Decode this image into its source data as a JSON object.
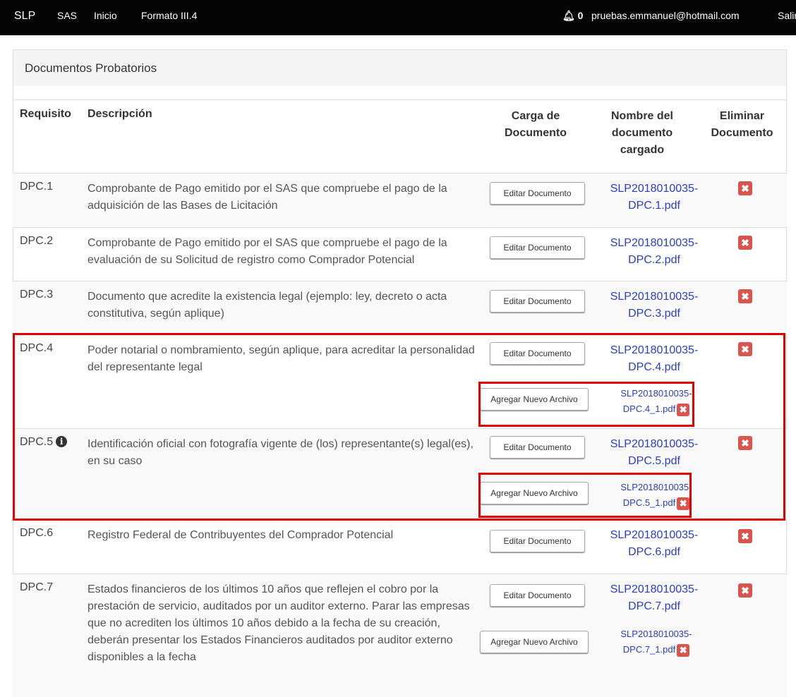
{
  "nav": {
    "brand": "SLP",
    "sas": "SAS",
    "inicio": "Inicio",
    "formato": "Formato III.4",
    "notifications": "0",
    "email": "pruebas.emmanuel@hotmail.com",
    "salir": "Salir"
  },
  "panel": {
    "title": "Documentos Probatorios"
  },
  "table": {
    "headers": {
      "requisito": "Requisito",
      "descripcion": "Descripción",
      "carga": "Carga de Documento",
      "nombre": "Nombre del documento cargado",
      "eliminar": "Eliminar Documento"
    },
    "rows": [
      {
        "req": "DPC.1",
        "desc": "Comprobante de Pago emitido por el SAS que compruebe el pago de la adquisición de las Bases de Licitación",
        "edit_label": "Editar Documento",
        "file": "SLP2018010035-DPC.1.pdf"
      },
      {
        "req": "DPC.2",
        "desc": "Comprobante de Pago emitido por el SAS que compruebe el pago de la evaluación de su Solicitud de registro como Comprador Potencial",
        "edit_label": "Editar Documento",
        "file": "SLP2018010035-DPC.2.pdf"
      },
      {
        "req": "DPC.3",
        "desc": "Documento que acredite la existencia legal (ejemplo: ley, decreto o acta constitutiva, según aplique)",
        "edit_label": "Editar Documento",
        "file": "SLP2018010035-DPC.3.pdf"
      },
      {
        "req": "DPC.4",
        "desc": "Poder notarial o nombramiento, según aplique, para acreditar la personalidad del representante legal",
        "edit_label": "Editar Documento",
        "file": "SLP2018010035-DPC.4.pdf",
        "add_label": "Agregar Nuevo Archivo",
        "extra_file": "SLP2018010035-DPC.4_1.pdf"
      },
      {
        "req": "DPC.5",
        "desc": "Identificación oficial con fotografía vigente de (los) representante(s) legal(es), en su caso",
        "edit_label": "Editar Documento",
        "file": "SLP2018010035-DPC.5.pdf",
        "add_label": "Agregar Nuevo Archivo",
        "extra_file": "SLP2018010035-DPC.5_1.pdf"
      },
      {
        "req": "DPC.6",
        "desc": "Registro Federal de Contribuyentes del Comprador Potencial",
        "edit_label": "Editar Documento",
        "file": "SLP2018010035-DPC.6.pdf"
      },
      {
        "req": "DPC.7",
        "desc": "Estados financieros de los últimos 10 años que reflejen el cobro por la prestación de servicio, auditados por un auditor externo. Parar las empresas que no acrediten los últimos 10 años debido a la fecha de su creación, deberán presentar los Estados Financieros auditados por auditor externo disponibles a la fecha",
        "edit_label": "Editar Documento",
        "file": "SLP2018010035-DPC.7.pdf",
        "add_label": "Agregar Nuevo Archivo",
        "extra_file": "SLP2018010035-DPC.7_1.pdf"
      }
    ]
  },
  "colors": {
    "navbar": "#050505",
    "link": "#2a3ec6",
    "delete": "#d9534f",
    "highlight": "#e30000"
  },
  "icons": {
    "bell": "bell-icon",
    "delete": "remove-icon",
    "info": "info-circle-icon"
  }
}
